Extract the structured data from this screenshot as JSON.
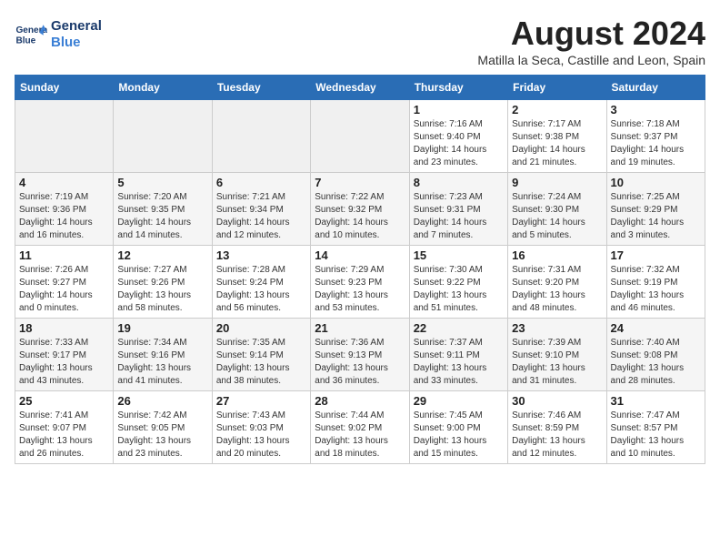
{
  "logo": {
    "name": "General",
    "name2": "Blue"
  },
  "title": "August 2024",
  "subtitle": "Matilla la Seca, Castille and Leon, Spain",
  "headers": [
    "Sunday",
    "Monday",
    "Tuesday",
    "Wednesday",
    "Thursday",
    "Friday",
    "Saturday"
  ],
  "weeks": [
    [
      {
        "num": "",
        "info": ""
      },
      {
        "num": "",
        "info": ""
      },
      {
        "num": "",
        "info": ""
      },
      {
        "num": "",
        "info": ""
      },
      {
        "num": "1",
        "info": "Sunrise: 7:16 AM\nSunset: 9:40 PM\nDaylight: 14 hours\nand 23 minutes."
      },
      {
        "num": "2",
        "info": "Sunrise: 7:17 AM\nSunset: 9:38 PM\nDaylight: 14 hours\nand 21 minutes."
      },
      {
        "num": "3",
        "info": "Sunrise: 7:18 AM\nSunset: 9:37 PM\nDaylight: 14 hours\nand 19 minutes."
      }
    ],
    [
      {
        "num": "4",
        "info": "Sunrise: 7:19 AM\nSunset: 9:36 PM\nDaylight: 14 hours\nand 16 minutes."
      },
      {
        "num": "5",
        "info": "Sunrise: 7:20 AM\nSunset: 9:35 PM\nDaylight: 14 hours\nand 14 minutes."
      },
      {
        "num": "6",
        "info": "Sunrise: 7:21 AM\nSunset: 9:34 PM\nDaylight: 14 hours\nand 12 minutes."
      },
      {
        "num": "7",
        "info": "Sunrise: 7:22 AM\nSunset: 9:32 PM\nDaylight: 14 hours\nand 10 minutes."
      },
      {
        "num": "8",
        "info": "Sunrise: 7:23 AM\nSunset: 9:31 PM\nDaylight: 14 hours\nand 7 minutes."
      },
      {
        "num": "9",
        "info": "Sunrise: 7:24 AM\nSunset: 9:30 PM\nDaylight: 14 hours\nand 5 minutes."
      },
      {
        "num": "10",
        "info": "Sunrise: 7:25 AM\nSunset: 9:29 PM\nDaylight: 14 hours\nand 3 minutes."
      }
    ],
    [
      {
        "num": "11",
        "info": "Sunrise: 7:26 AM\nSunset: 9:27 PM\nDaylight: 14 hours\nand 0 minutes."
      },
      {
        "num": "12",
        "info": "Sunrise: 7:27 AM\nSunset: 9:26 PM\nDaylight: 13 hours\nand 58 minutes."
      },
      {
        "num": "13",
        "info": "Sunrise: 7:28 AM\nSunset: 9:24 PM\nDaylight: 13 hours\nand 56 minutes."
      },
      {
        "num": "14",
        "info": "Sunrise: 7:29 AM\nSunset: 9:23 PM\nDaylight: 13 hours\nand 53 minutes."
      },
      {
        "num": "15",
        "info": "Sunrise: 7:30 AM\nSunset: 9:22 PM\nDaylight: 13 hours\nand 51 minutes."
      },
      {
        "num": "16",
        "info": "Sunrise: 7:31 AM\nSunset: 9:20 PM\nDaylight: 13 hours\nand 48 minutes."
      },
      {
        "num": "17",
        "info": "Sunrise: 7:32 AM\nSunset: 9:19 PM\nDaylight: 13 hours\nand 46 minutes."
      }
    ],
    [
      {
        "num": "18",
        "info": "Sunrise: 7:33 AM\nSunset: 9:17 PM\nDaylight: 13 hours\nand 43 minutes."
      },
      {
        "num": "19",
        "info": "Sunrise: 7:34 AM\nSunset: 9:16 PM\nDaylight: 13 hours\nand 41 minutes."
      },
      {
        "num": "20",
        "info": "Sunrise: 7:35 AM\nSunset: 9:14 PM\nDaylight: 13 hours\nand 38 minutes."
      },
      {
        "num": "21",
        "info": "Sunrise: 7:36 AM\nSunset: 9:13 PM\nDaylight: 13 hours\nand 36 minutes."
      },
      {
        "num": "22",
        "info": "Sunrise: 7:37 AM\nSunset: 9:11 PM\nDaylight: 13 hours\nand 33 minutes."
      },
      {
        "num": "23",
        "info": "Sunrise: 7:39 AM\nSunset: 9:10 PM\nDaylight: 13 hours\nand 31 minutes."
      },
      {
        "num": "24",
        "info": "Sunrise: 7:40 AM\nSunset: 9:08 PM\nDaylight: 13 hours\nand 28 minutes."
      }
    ],
    [
      {
        "num": "25",
        "info": "Sunrise: 7:41 AM\nSunset: 9:07 PM\nDaylight: 13 hours\nand 26 minutes."
      },
      {
        "num": "26",
        "info": "Sunrise: 7:42 AM\nSunset: 9:05 PM\nDaylight: 13 hours\nand 23 minutes."
      },
      {
        "num": "27",
        "info": "Sunrise: 7:43 AM\nSunset: 9:03 PM\nDaylight: 13 hours\nand 20 minutes."
      },
      {
        "num": "28",
        "info": "Sunrise: 7:44 AM\nSunset: 9:02 PM\nDaylight: 13 hours\nand 18 minutes."
      },
      {
        "num": "29",
        "info": "Sunrise: 7:45 AM\nSunset: 9:00 PM\nDaylight: 13 hours\nand 15 minutes."
      },
      {
        "num": "30",
        "info": "Sunrise: 7:46 AM\nSunset: 8:59 PM\nDaylight: 13 hours\nand 12 minutes."
      },
      {
        "num": "31",
        "info": "Sunrise: 7:47 AM\nSunset: 8:57 PM\nDaylight: 13 hours\nand 10 minutes."
      }
    ]
  ]
}
